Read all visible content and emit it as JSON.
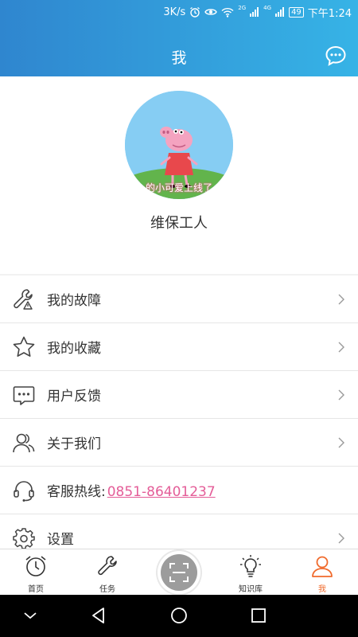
{
  "status_bar": {
    "speed": "3K/s",
    "network1": "2G",
    "network2": "4G",
    "battery": "49",
    "time": "下午1:24"
  },
  "header": {
    "title": "我",
    "chat_icon": "chat-bubble-icon"
  },
  "profile": {
    "avatar_caption": "的小可爱上线了",
    "name": "维保工人"
  },
  "menu": {
    "items": [
      {
        "label": "我的故障",
        "icon": "wrench-warning-icon",
        "has_chevron": true
      },
      {
        "label": "我的收藏",
        "icon": "star-icon",
        "has_chevron": true
      },
      {
        "label": "用户反馈",
        "icon": "feedback-icon",
        "has_chevron": true
      },
      {
        "label": "关于我们",
        "icon": "users-icon",
        "has_chevron": true
      },
      {
        "label": "客服热线:",
        "value": "0851-86401237",
        "icon": "headset-icon",
        "has_chevron": false
      },
      {
        "label": "设置",
        "icon": "gear-icon",
        "has_chevron": true
      }
    ]
  },
  "bottom_nav": {
    "items": [
      {
        "label": "首页",
        "icon": "clock-icon"
      },
      {
        "label": "任务",
        "icon": "wrench-icon"
      },
      {
        "label": "知识库",
        "icon": "lightbulb-icon"
      },
      {
        "label": "我",
        "icon": "user-icon",
        "active": true
      }
    ],
    "scan_icon": "scan-icon"
  },
  "colors": {
    "header_start": "#2f86cf",
    "header_end": "#36b3e6",
    "accent": "#f06a2c",
    "phone": "#e45d98"
  }
}
